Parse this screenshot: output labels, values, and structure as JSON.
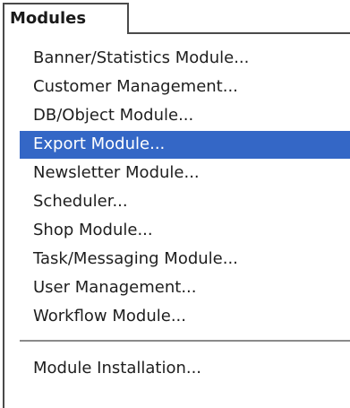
{
  "menu": {
    "title": "Modules",
    "items": [
      "Banner/Statistics Module...",
      "Customer Management...",
      "DB/Object Module...",
      "Export Module...",
      "Newsletter Module...",
      "Scheduler...",
      "Shop Module...",
      "Task/Messaging Module...",
      "User Management...",
      "Workflow Module..."
    ],
    "footer_item": "Module Installation...",
    "selected_item": "Export Module...",
    "colors": {
      "selection_background": "#3467c6",
      "selection_text": "#ffffff",
      "text": "#1e1e1e",
      "border": "#4a4a4a"
    }
  }
}
